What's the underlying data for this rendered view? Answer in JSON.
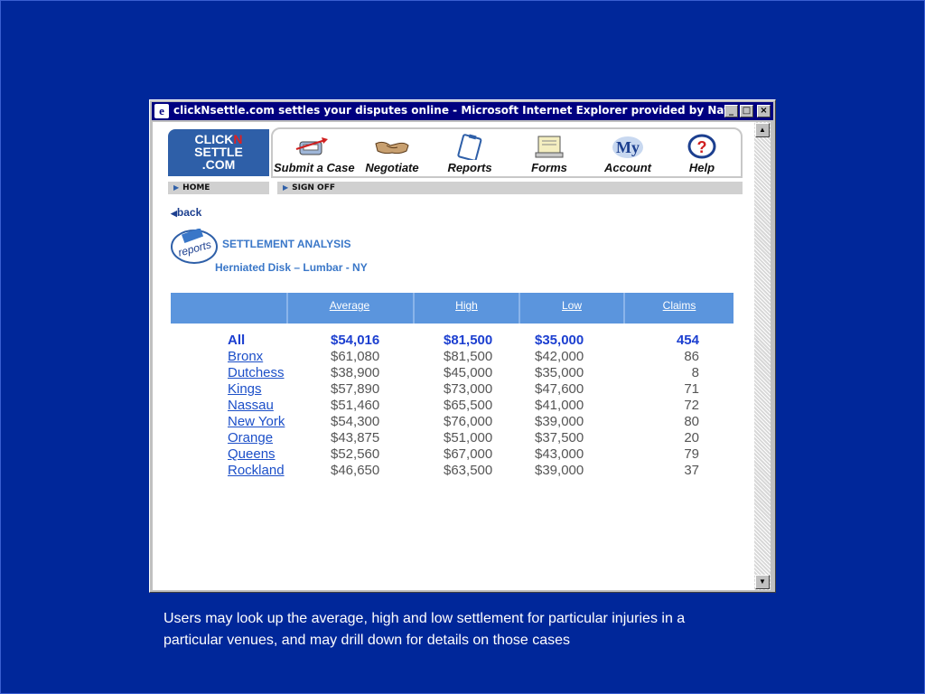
{
  "window": {
    "title": "clickNsettle.com settles your disputes online - Microsoft Internet Explorer provided by National Arb...",
    "minimize": "_",
    "maximize": "□",
    "close": "×"
  },
  "logo": {
    "line1_a": "CLICK",
    "line1_b": "N",
    "line2": "SETTLE",
    "line3": ".COM"
  },
  "nav": {
    "items": [
      {
        "label": "Submit a Case",
        "icon": "submit-case-icon"
      },
      {
        "label": "Negotiate",
        "icon": "handshake-icon"
      },
      {
        "label": "Reports",
        "icon": "clipboard-icon"
      },
      {
        "label": "Forms",
        "icon": "forms-icon"
      },
      {
        "label": "Account",
        "icon": "my-account-icon",
        "icon_text": "My"
      },
      {
        "label": "Help",
        "icon": "help-icon",
        "icon_text": "?"
      }
    ],
    "home": "HOME",
    "sign_off": "SIGN OFF"
  },
  "back": "back",
  "badge": "reports",
  "heading": "SETTLEMENT ANALYSIS",
  "subheading": "Herniated Disk – Lumbar - NY",
  "table": {
    "columns": [
      "Average",
      "High",
      "Low",
      "Claims"
    ],
    "rows": [
      {
        "name": "All",
        "avg": "$54,016",
        "high": "$81,500",
        "low": "$35,000",
        "claims": "454"
      },
      {
        "name": "Bronx",
        "avg": "$61,080",
        "high": "$81,500",
        "low": "$42,000",
        "claims": "86"
      },
      {
        "name": "Dutchess",
        "avg": "$38,900",
        "high": "$45,000",
        "low": "$35,000",
        "claims": "8"
      },
      {
        "name": "Kings",
        "avg": "$57,890",
        "high": "$73,000",
        "low": "$47,600",
        "claims": "71"
      },
      {
        "name": "Nassau",
        "avg": "$51,460",
        "high": "$65,500",
        "low": "$41,000",
        "claims": "72"
      },
      {
        "name": "New York",
        "avg": "$54,300",
        "high": "$76,000",
        "low": "$39,000",
        "claims": "80"
      },
      {
        "name": "Orange",
        "avg": "$43,875",
        "high": "$51,000",
        "low": "$37,500",
        "claims": "20"
      },
      {
        "name": "Queens",
        "avg": "$52,560",
        "high": "$67,000",
        "low": "$43,000",
        "claims": "79"
      },
      {
        "name": "Rockland",
        "avg": "$46,650",
        "high": "$63,500",
        "low": "$39,000",
        "claims": "37"
      }
    ]
  },
  "caption": "Users may look up the average, high and low settlement for particular injuries in a particular venues, and may drill down for details on those cases",
  "colors": {
    "slide_bg": "#00279a",
    "titlebar": "#000080",
    "table_header": "#5b95dd",
    "link": "#1c4fc8"
  }
}
